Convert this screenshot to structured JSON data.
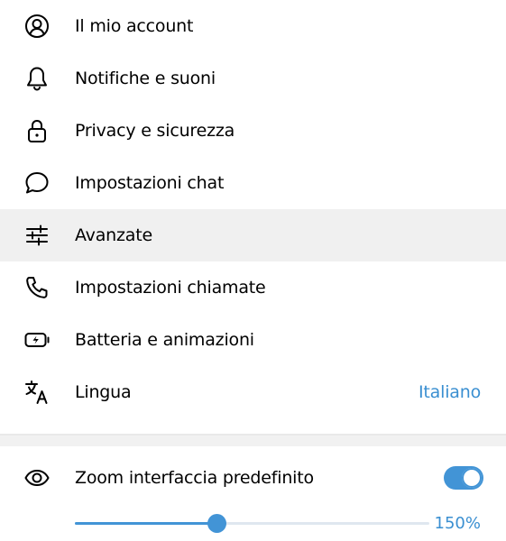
{
  "menu": {
    "items": [
      {
        "icon": "account-icon",
        "label": "Il mio account"
      },
      {
        "icon": "bell-icon",
        "label": "Notifiche e suoni"
      },
      {
        "icon": "lock-icon",
        "label": "Privacy e sicurezza"
      },
      {
        "icon": "chat-bubble-icon",
        "label": "Impostazioni chat"
      },
      {
        "icon": "sliders-icon",
        "label": "Avanzate"
      },
      {
        "icon": "phone-icon",
        "label": "Impostazioni chiamate"
      },
      {
        "icon": "battery-icon",
        "label": "Batteria e animazioni"
      },
      {
        "icon": "translate-icon",
        "label": "Lingua",
        "value": "Italiano"
      }
    ],
    "active_item": "Avanzate"
  },
  "zoom": {
    "icon": "eye-icon",
    "label": "Zoom interfaccia predefinito",
    "toggle_on": true,
    "slider_fraction": 0.4,
    "value": "150%"
  },
  "colors": {
    "accent": "#4294d6",
    "link_text": "#3a8fd1",
    "active_row_bg": "#f0f0f0"
  }
}
